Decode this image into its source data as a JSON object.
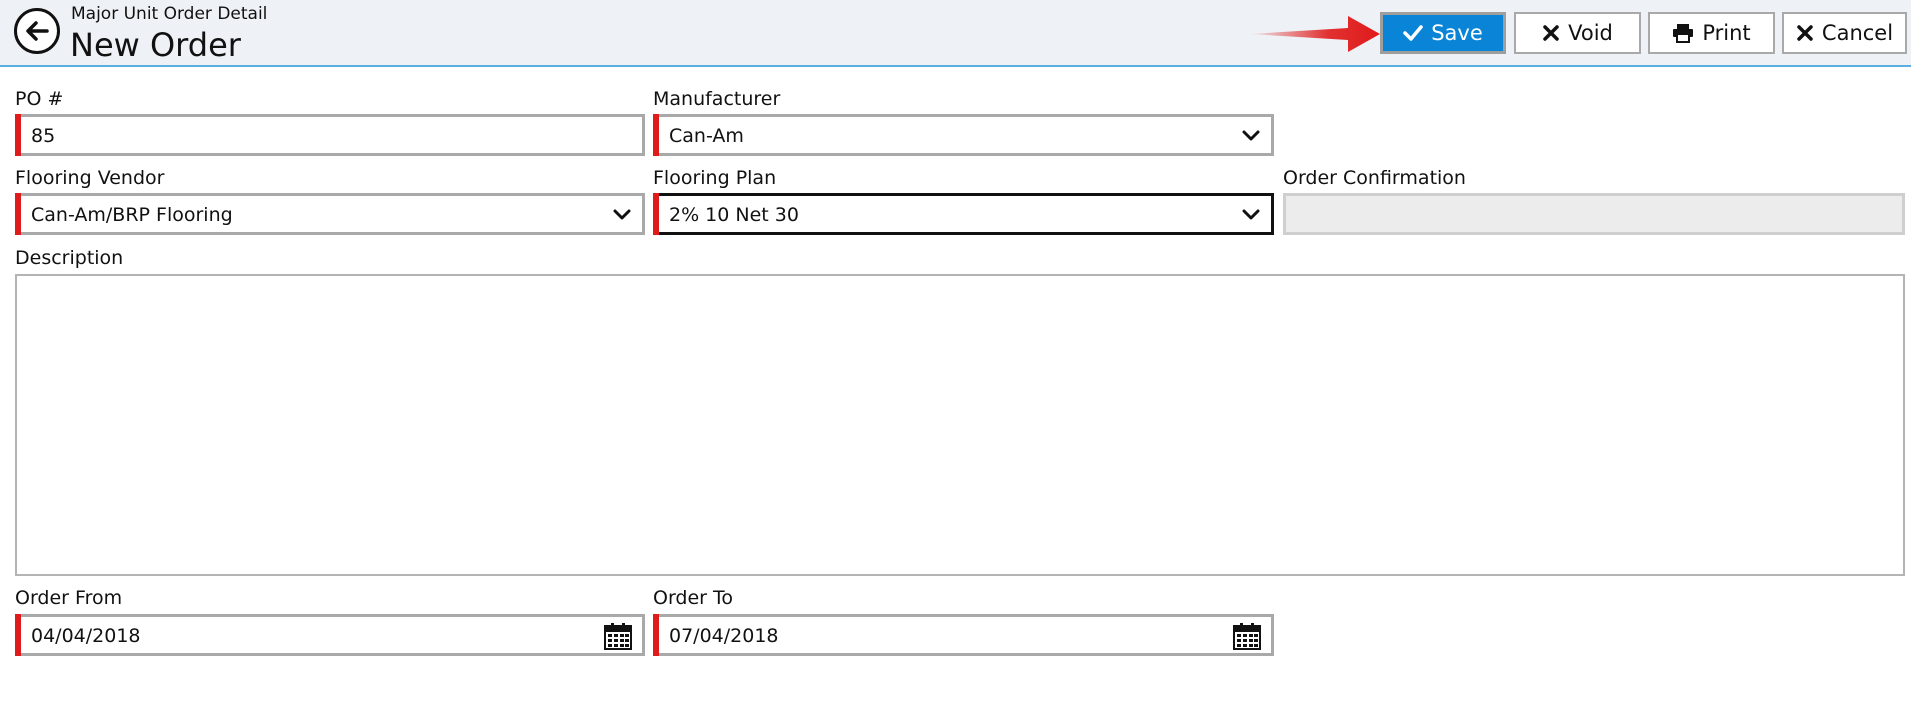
{
  "header": {
    "subtitle": "Major Unit Order Detail",
    "title": "New Order",
    "back_icon": "arrow-left-circle-icon"
  },
  "toolbar": {
    "save_label": "Save",
    "void_label": "Void",
    "print_label": "Print",
    "cancel_label": "Cancel",
    "highlight_arrow_color": "#e01b1b"
  },
  "form": {
    "po_label": "PO #",
    "po_value": "85",
    "manufacturer_label": "Manufacturer",
    "manufacturer_value": "Can-Am",
    "flooring_vendor_label": "Flooring Vendor",
    "flooring_vendor_value": "Can-Am/BRP Flooring",
    "flooring_plan_label": "Flooring Plan",
    "flooring_plan_value": "2% 10 Net 30",
    "order_confirmation_label": "Order Confirmation",
    "order_confirmation_value": "",
    "description_label": "Description",
    "description_value": "",
    "order_from_label": "Order From",
    "order_from_value": "04/04/2018",
    "order_to_label": "Order To",
    "order_to_value": "07/04/2018"
  },
  "colors": {
    "accent": "#0a84d6",
    "required": "#e01b1b",
    "header_bg": "#eef2f6",
    "header_line": "#5aaee0"
  }
}
